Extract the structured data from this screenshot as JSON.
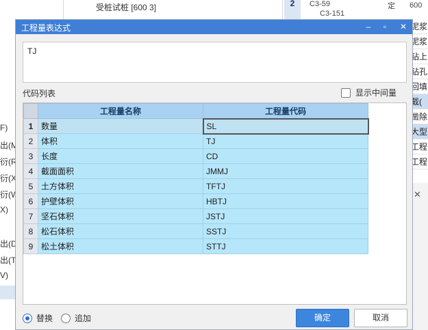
{
  "background": {
    "tree_text": "受桩试桩 [600 3]",
    "grid_head_label": "2",
    "grid_cells": [
      "C3-59",
      "C3-151",
      "定",
      "600"
    ],
    "right_rows": [
      "泥浆",
      "泥浆",
      "钻上",
      "钻孔",
      "回填",
      "截(",
      "凿除",
      "大型",
      "工程",
      "工程"
    ],
    "left_items": [
      "F)",
      "出(M)",
      "衍(R)",
      "衍(X)",
      "衍(W)",
      "X)",
      "出(D)",
      "出(T)",
      "V)"
    ]
  },
  "dialog": {
    "title": "工程量表达式",
    "expression": "TJ",
    "code_list_label": "代码列表",
    "show_intermediate_label": "显示中间量",
    "show_intermediate_checked": false,
    "columns": [
      "工程量名称",
      "工程量代码"
    ],
    "rows": [
      {
        "index": "1",
        "name": "数量",
        "code": "SL"
      },
      {
        "index": "2",
        "name": "体积",
        "code": "TJ"
      },
      {
        "index": "3",
        "name": "长度",
        "code": "CD"
      },
      {
        "index": "4",
        "name": "截面面积",
        "code": "JMMJ"
      },
      {
        "index": "5",
        "name": "土方体积",
        "code": "TFTJ"
      },
      {
        "index": "6",
        "name": "护壁体积",
        "code": "HBTJ"
      },
      {
        "index": "7",
        "name": "坚石体积",
        "code": "JSTJ"
      },
      {
        "index": "8",
        "name": "松石体积",
        "code": "SSTJ"
      },
      {
        "index": "9",
        "name": "松土体积",
        "code": "STTJ"
      }
    ],
    "selected_row": 0,
    "mode_replace_label": "替换",
    "mode_append_label": "追加",
    "mode_selected": "replace",
    "ok_label": "确定",
    "cancel_label": "取消",
    "colors": {
      "titlebar": "#3f7fd6",
      "header": "#a9d2f2",
      "cell": "#b6e6f9",
      "ok_button": "#3d86dd"
    }
  }
}
